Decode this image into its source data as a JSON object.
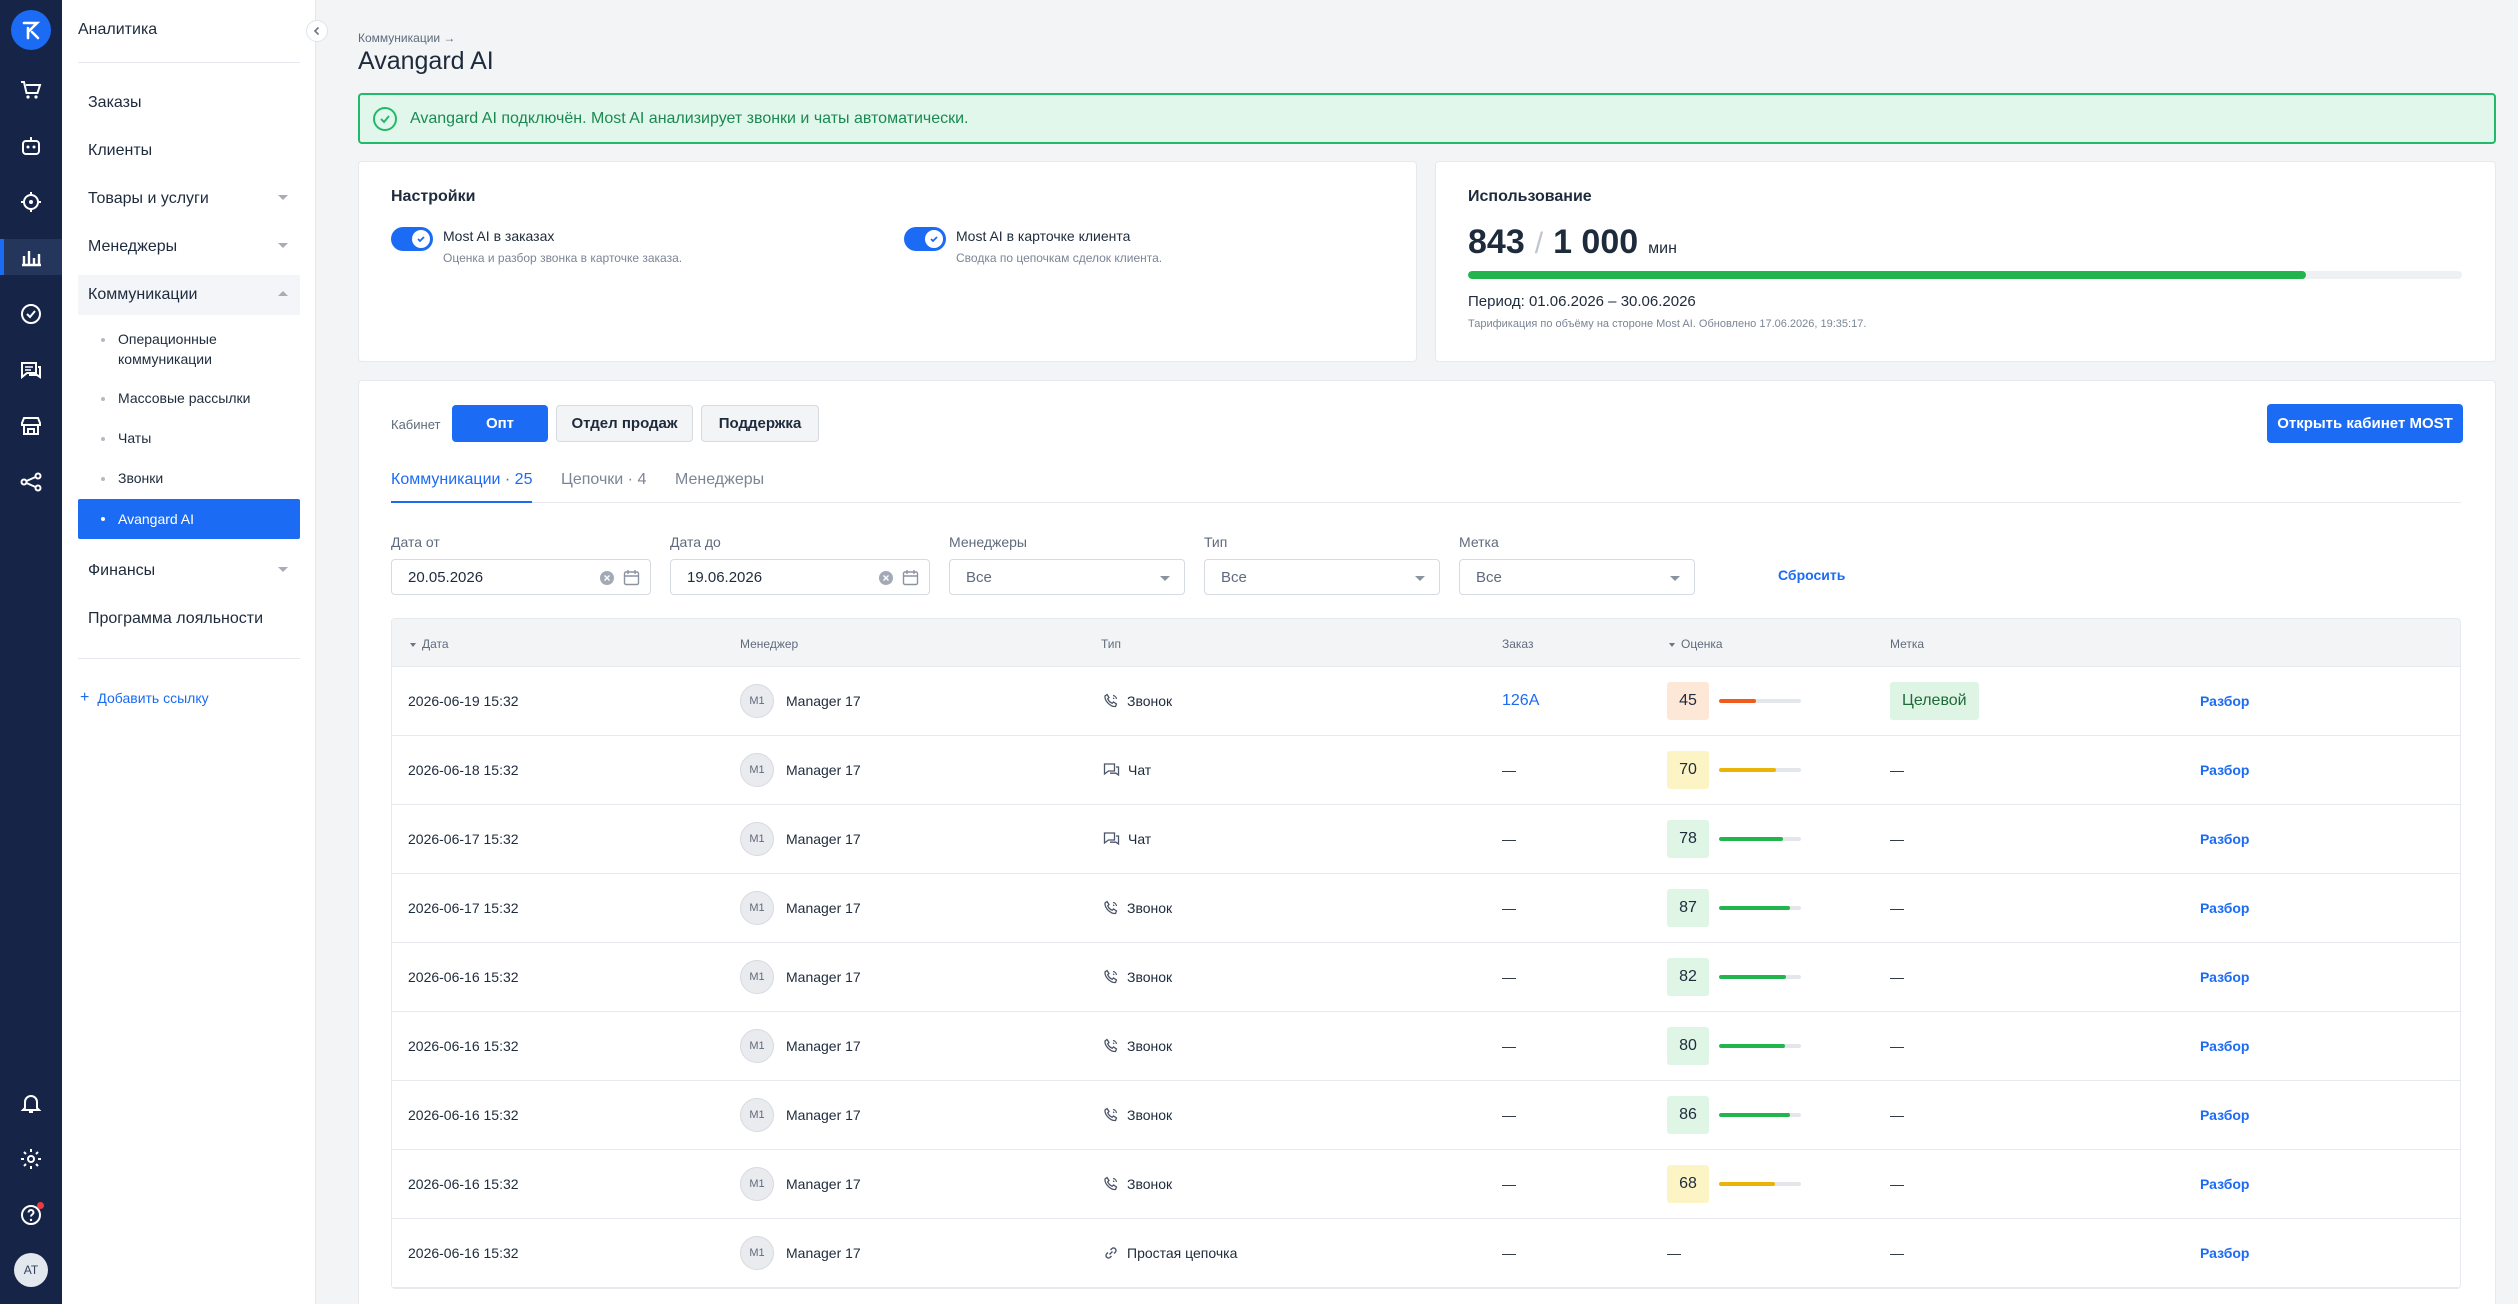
{
  "rail": {
    "avatar": "AT",
    "icons": [
      "logo-icon",
      "cart-icon",
      "robot-icon",
      "target-icon",
      "analytics-icon",
      "check-circle-icon",
      "chat-icon",
      "store-icon",
      "integrations-icon",
      "bell-icon",
      "settings-icon",
      "help-icon"
    ]
  },
  "sidebar": {
    "header": "Аналитика",
    "items": [
      {
        "label": "Заказы"
      },
      {
        "label": "Клиенты"
      },
      {
        "label": "Товары и услуги"
      },
      {
        "label": "Менеджеры"
      },
      {
        "label": "Коммуникации"
      }
    ],
    "sub_items": [
      {
        "label": "Операционные коммуникации"
      },
      {
        "label": "Массовые рассылки"
      },
      {
        "label": "Чаты"
      },
      {
        "label": "Звонки"
      },
      {
        "label": "Avangard AI"
      }
    ],
    "items_after": [
      {
        "label": "Финансы"
      },
      {
        "label": "Программа лояльности"
      }
    ],
    "add_link": "Добавить ссылку"
  },
  "header": {
    "breadcrumb": "Коммуникации →",
    "title": "Avangard AI"
  },
  "alert": {
    "text": "Avangard AI подключён. Most AI анализирует звонки и чаты автоматически."
  },
  "settings": {
    "title": "Настройки",
    "toggles": [
      {
        "label": "Most AI в заказах",
        "desc": "Оценка и разбор звонка в карточке заказа.",
        "on": true
      },
      {
        "label": "Most AI в карточке клиента",
        "desc": "Сводка по цепочкам сделок клиента.",
        "on": true
      }
    ]
  },
  "usage": {
    "title": "Использование",
    "used": "843",
    "slash": "/",
    "total": "1 000",
    "unit": "мин",
    "fraction": 0.843,
    "period": "Период: 01.06.2026 – 30.06.2026",
    "note": "Тарификация по объёму на стороне Most AI. Обновлено 17.06.2026, 19:35:17."
  },
  "cabinet": {
    "label": "Кабинет",
    "options": [
      "Опт",
      "Отдел продаж",
      "Поддержка"
    ],
    "selected": "Опт",
    "open_button": "Открыть кабинет MOST"
  },
  "tabs": [
    {
      "label": "Коммуникации · 25",
      "active": true
    },
    {
      "label": "Цепочки · 4",
      "active": false
    },
    {
      "label": "Менеджеры",
      "active": false
    }
  ],
  "filters": {
    "date_from": {
      "label": "Дата от",
      "value": "20.05.2026"
    },
    "date_to": {
      "label": "Дата до",
      "value": "19.06.2026"
    },
    "managers": {
      "label": "Менеджеры",
      "value": "Все"
    },
    "type": {
      "label": "Тип",
      "value": "Все"
    },
    "tag": {
      "label": "Метка",
      "value": "Все"
    },
    "reset": "Сбросить"
  },
  "table": {
    "columns": [
      "Дата",
      "Менеджер",
      "Тип",
      "Заказ",
      "Оценка",
      "Метка"
    ],
    "rows": [
      {
        "date": "2026-06-19 15:32",
        "initials": "M1",
        "manager": "Manager 17",
        "type": "Звонок",
        "type_icon": "phone-icon",
        "order": "126A",
        "score": "45",
        "score_value": 45,
        "score_color": "#f05a1a",
        "score_bg": "#fde8d8",
        "tag": "Целевой",
        "action": "Разбор"
      },
      {
        "date": "2026-06-18 15:32",
        "initials": "M1",
        "manager": "Manager 17",
        "type": "Чат",
        "type_icon": "chat-icon",
        "order": "—",
        "score": "70",
        "score_value": 70,
        "score_color": "#eab308",
        "score_bg": "#fdf4c6",
        "tag": "—",
        "action": "Разбор"
      },
      {
        "date": "2026-06-17 15:32",
        "initials": "M1",
        "manager": "Manager 17",
        "type": "Чат",
        "type_icon": "chat-icon",
        "order": "—",
        "score": "78",
        "score_value": 78,
        "score_color": "#22b44d",
        "score_bg": "#dff5e5",
        "tag": "—",
        "action": "Разбор"
      },
      {
        "date": "2026-06-17 15:32",
        "initials": "M1",
        "manager": "Manager 17",
        "type": "Звонок",
        "type_icon": "phone-icon",
        "order": "—",
        "score": "87",
        "score_value": 87,
        "score_color": "#22b44d",
        "score_bg": "#dff5e5",
        "tag": "—",
        "action": "Разбор"
      },
      {
        "date": "2026-06-16 15:32",
        "initials": "M1",
        "manager": "Manager 17",
        "type": "Звонок",
        "type_icon": "phone-icon",
        "order": "—",
        "score": "82",
        "score_value": 82,
        "score_color": "#22b44d",
        "score_bg": "#dff5e5",
        "tag": "—",
        "action": "Разбор"
      },
      {
        "date": "2026-06-16 15:32",
        "initials": "M1",
        "manager": "Manager 17",
        "type": "Звонок",
        "type_icon": "phone-icon",
        "order": "—",
        "score": "80",
        "score_value": 80,
        "score_color": "#22b44d",
        "score_bg": "#dff5e5",
        "tag": "—",
        "action": "Разбор"
      },
      {
        "date": "2026-06-16 15:32",
        "initials": "M1",
        "manager": "Manager 17",
        "type": "Звонок",
        "type_icon": "phone-icon",
        "order": "—",
        "score": "86",
        "score_value": 86,
        "score_color": "#22b44d",
        "score_bg": "#dff5e5",
        "tag": "—",
        "action": "Разбор"
      },
      {
        "date": "2026-06-16 15:32",
        "initials": "M1",
        "manager": "Manager 17",
        "type": "Звонок",
        "type_icon": "phone-icon",
        "order": "—",
        "score": "68",
        "score_value": 68,
        "score_color": "#eab308",
        "score_bg": "#fdf4c6",
        "tag": "—",
        "action": "Разбор"
      },
      {
        "date": "2026-06-16 15:32",
        "initials": "M1",
        "manager": "Manager 17",
        "type": "Простая цепочка",
        "type_icon": "link-icon",
        "order": "—",
        "score": "—",
        "score_value": null,
        "score_color": "",
        "score_bg": "",
        "tag": "—",
        "action": "Разбор"
      }
    ]
  }
}
